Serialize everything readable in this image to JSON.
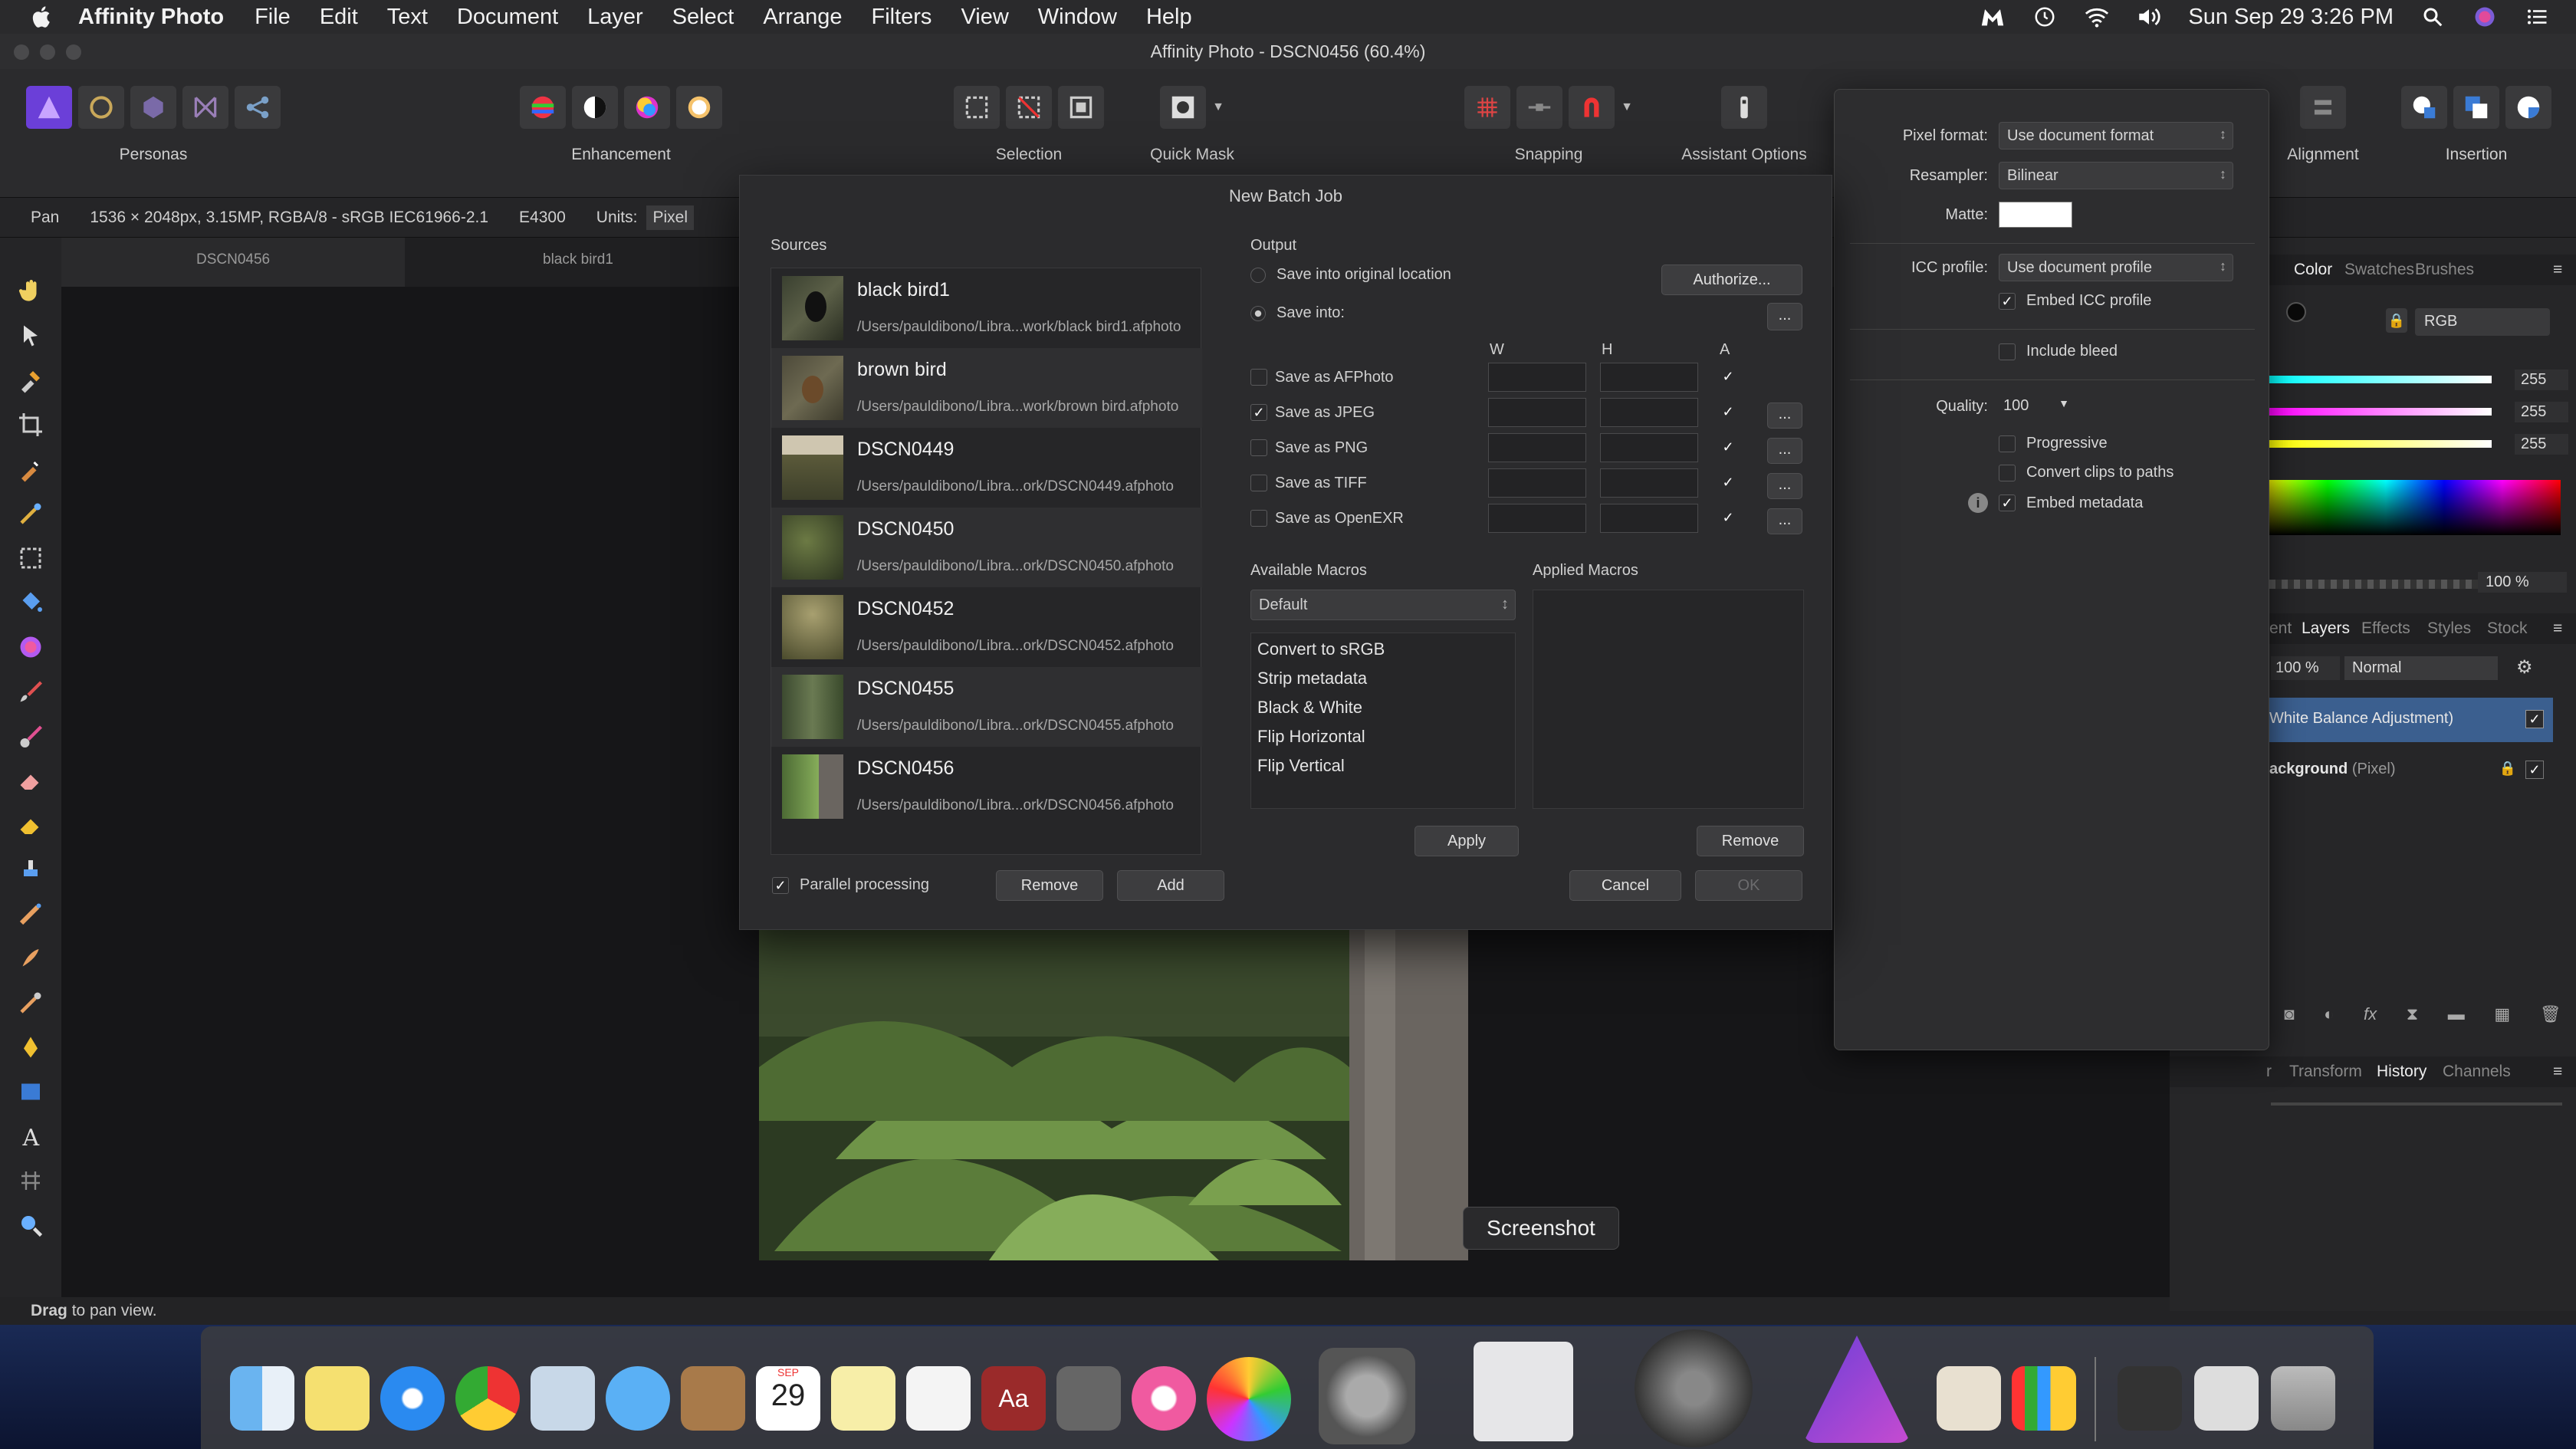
{
  "menubar": {
    "app": "Affinity Photo",
    "items": [
      "File",
      "Edit",
      "Text",
      "Document",
      "Layer",
      "Select",
      "Arrange",
      "Filters",
      "View",
      "Window",
      "Help"
    ],
    "clock": "Sun Sep 29  3:26 PM"
  },
  "window": {
    "title": "Affinity Photo - DSCN0456 (60.4%)"
  },
  "toolbar": {
    "personas": "Personas",
    "enhancement": "Enhancement",
    "selection": "Selection",
    "quickmask": "Quick Mask",
    "snapping": "Snapping",
    "assistant": "Assistant Options",
    "alignment": "Alignment",
    "insertion": "Insertion"
  },
  "context": {
    "tool": "Pan",
    "info": "1536 × 2048px, 3.15MP, RGBA/8 - sRGB IEC61966-2.1",
    "camera": "E4300",
    "units_label": "Units:",
    "units_value": "Pixel"
  },
  "doc_tabs": [
    "DSCN0456",
    "black bird1"
  ],
  "status": {
    "bold": "Drag",
    "text": " to pan view."
  },
  "batch": {
    "title": "New Batch Job",
    "sources_label": "Sources",
    "sources": [
      {
        "name": "black bird1",
        "path": "/Users/pauldibono/Libra...work/black bird1.afphoto"
      },
      {
        "name": "brown bird",
        "path": "/Users/pauldibono/Libra...work/brown bird.afphoto"
      },
      {
        "name": "DSCN0449",
        "path": "/Users/pauldibono/Libra...ork/DSCN0449.afphoto"
      },
      {
        "name": "DSCN0450",
        "path": "/Users/pauldibono/Libra...ork/DSCN0450.afphoto"
      },
      {
        "name": "DSCN0452",
        "path": "/Users/pauldibono/Libra...ork/DSCN0452.afphoto"
      },
      {
        "name": "DSCN0455",
        "path": "/Users/pauldibono/Libra...ork/DSCN0455.afphoto"
      },
      {
        "name": "DSCN0456",
        "path": "/Users/pauldibono/Libra...ork/DSCN0456.afphoto"
      }
    ],
    "output_label": "Output",
    "save_original": "Save into original location",
    "authorize": "Authorize...",
    "save_into": "Save into:",
    "col_w": "W",
    "col_h": "H",
    "col_a": "A",
    "formats": [
      {
        "label": "Save as AFPhoto",
        "checked": false
      },
      {
        "label": "Save as JPEG",
        "checked": true
      },
      {
        "label": "Save as PNG",
        "checked": false
      },
      {
        "label": "Save as TIFF",
        "checked": false
      },
      {
        "label": "Save as OpenEXR",
        "checked": false
      }
    ],
    "ellipsis": "...",
    "available_macros_label": "Available Macros",
    "applied_macros_label": "Applied Macros",
    "macro_category": "Default",
    "macros": [
      "Convert to sRGB",
      "Strip metadata",
      "Black & White",
      "Flip Horizontal",
      "Flip Vertical"
    ],
    "apply": "Apply",
    "remove_macro": "Remove",
    "parallel": "Parallel processing",
    "remove": "Remove",
    "add": "Add",
    "cancel": "Cancel",
    "ok": "OK"
  },
  "export": {
    "pixel_format_label": "Pixel format:",
    "pixel_format": "Use document format",
    "resampler_label": "Resampler:",
    "resampler": "Bilinear",
    "matte_label": "Matte:",
    "icc_label": "ICC profile:",
    "icc": "Use document profile",
    "embed_icc": "Embed ICC profile",
    "include_bleed": "Include bleed",
    "quality_label": "Quality:",
    "quality": "100",
    "progressive": "Progressive",
    "convert_clips": "Convert clips to paths",
    "embed_metadata": "Embed metadata"
  },
  "studio": {
    "color_tabs": [
      "Color",
      "Swatches",
      "Brushes"
    ],
    "color_mode": "RGB",
    "slider_values": [
      "255",
      "255",
      "255"
    ],
    "opacity": "100 %",
    "layer_tabs": [
      "ent",
      "Layers",
      "Effects",
      "Styles",
      "Stock"
    ],
    "layer_opacity": "100 %",
    "blend_mode": "Normal",
    "layers": [
      {
        "name": "White Balance Adjustment)",
        "type": ""
      },
      {
        "name": "ackground",
        "type": "(Pixel)"
      }
    ],
    "bottom_tabs": [
      "r",
      "Transform",
      "History",
      "Channels"
    ]
  },
  "tooltip": "Screenshot",
  "dock": {
    "calendar_month": "SEP",
    "calendar_day": "29"
  }
}
